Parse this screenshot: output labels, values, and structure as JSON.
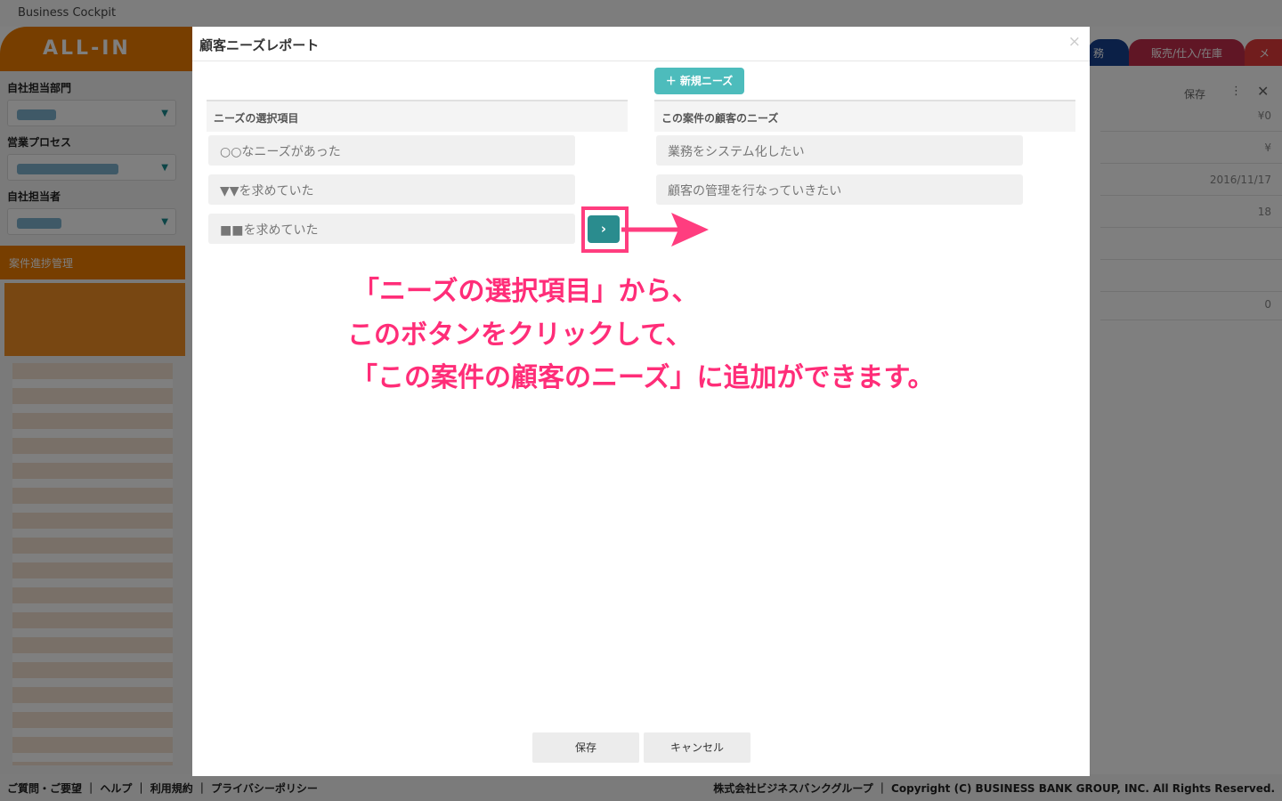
{
  "app": {
    "title": "Business Cockpit",
    "logo": "ALL-IN",
    "sidebar": {
      "dept_label": "自社担当部門",
      "process_label": "営業プロセス",
      "owner_label": "自社担当者",
      "section_label": "案件進捗管理"
    },
    "tabs": [
      {
        "label": "務"
      },
      {
        "label": "販売/仕入/在庫"
      },
      {
        "label": "メ"
      }
    ],
    "panel": {
      "save_label": "保存",
      "ellipsis": "⋮",
      "close": "✕",
      "rows": [
        "¥0",
        "¥",
        "2016/11/17",
        "18",
        "",
        "",
        "0"
      ]
    },
    "footer": {
      "left": "ご質問・ご要望 ｜ ヘルプ ｜ 利用規約 ｜ プライバシーポリシー",
      "right": "株式会社ビジネスバンクグループ ｜ Copyright (C) BUSINESS BANK GROUP, INC. All Rights Reserved."
    }
  },
  "modal": {
    "title": "顧客ニーズレポート",
    "close": "×",
    "new_button": "＋ 新規ニーズ",
    "left_header": "ニーズの選択項目",
    "right_header": "この案件の顧客のニーズ",
    "left_items": [
      "○○なニーズがあった",
      "▼▼を求めていた",
      "■■を求めていた"
    ],
    "right_items": [
      "業務をシステム化したい",
      "顧客の管理を行なっていきたい"
    ],
    "move_button": "›",
    "save_button": "保存",
    "cancel_button": "キャンセル"
  },
  "annotation": {
    "line1": "「ニーズの選択項目」から、",
    "line2": "このボタンをクリックして、",
    "line3": "「この案件の顧客のニーズ」に追加ができます。",
    "color": "#ff2d78"
  }
}
